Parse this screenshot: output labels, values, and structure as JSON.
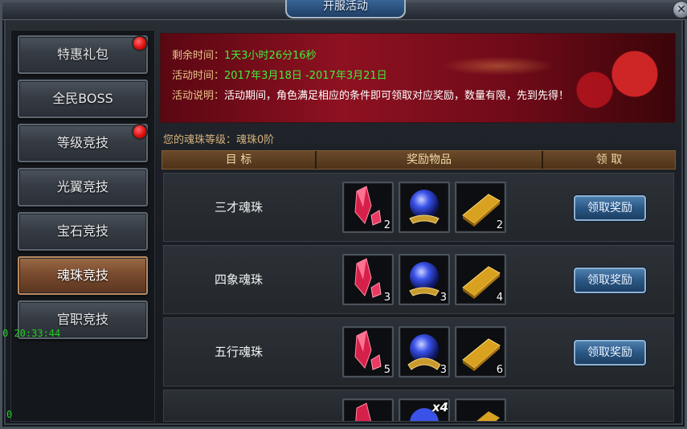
{
  "window": {
    "title": "开服活动",
    "close_label": "✕"
  },
  "sidebar": {
    "items": [
      {
        "label": "特惠礼包",
        "badge": true,
        "active": false
      },
      {
        "label": "全民BOSS",
        "badge": false,
        "active": false
      },
      {
        "label": "等级竞技",
        "badge": true,
        "active": false
      },
      {
        "label": "光翼竞技",
        "badge": false,
        "active": false
      },
      {
        "label": "宝石竞技",
        "badge": false,
        "active": false
      },
      {
        "label": "魂珠竞技",
        "badge": false,
        "active": true
      },
      {
        "label": "官职竞技",
        "badge": false,
        "active": false
      }
    ]
  },
  "debug": {
    "time": "0 20:33:44",
    "zero": "0"
  },
  "banner": {
    "remaining_label": "剩余时间：",
    "remaining_value": "1天3小时26分16秒",
    "period_label": "活动时间：",
    "period_value": "2017年3月18日 -2017年3月21日",
    "desc_label": "活动说明：",
    "desc_value": "活动期间，角色满足相应的条件即可领取对应奖励，数量有限，先到先得！"
  },
  "level_text": "您的魂珠等级：魂珠0阶",
  "table": {
    "headers": [
      "目 标",
      "奖励物品",
      "领 取"
    ],
    "rows": [
      {
        "name": "三才魂珠",
        "items": [
          {
            "icon": "red-crystal-icon",
            "qty": "2"
          },
          {
            "icon": "blue-orb-icon",
            "qty": ""
          },
          {
            "icon": "gold-bar-icon",
            "qty": "2"
          }
        ],
        "button": "领取奖励"
      },
      {
        "name": "四象魂珠",
        "items": [
          {
            "icon": "red-crystal-icon",
            "qty": "3"
          },
          {
            "icon": "blue-orb-icon",
            "qty": "3"
          },
          {
            "icon": "gold-bar-icon",
            "qty": "4"
          }
        ],
        "button": "领取奖励"
      },
      {
        "name": "五行魂珠",
        "items": [
          {
            "icon": "red-crystal-icon",
            "qty": "5"
          },
          {
            "icon": "blue-orb-icon",
            "qty": "3"
          },
          {
            "icon": "gold-bar-icon",
            "qty": "6"
          }
        ],
        "button": "领取奖励"
      }
    ],
    "partial_row_badge": "x4"
  }
}
